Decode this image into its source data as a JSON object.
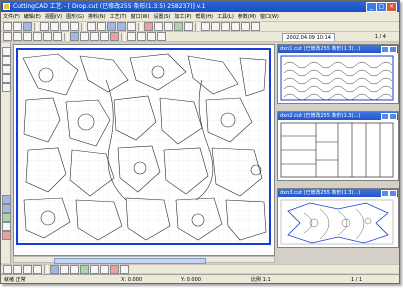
{
  "window": {
    "title": "CuttingCAD 工艺 - [ Drop.cut  (已修改255 条形(1.3.5) 258237)] v.1",
    "buttons": [
      "_",
      "□",
      "×"
    ]
  },
  "menu": {
    "items": [
      "文件(F)",
      "编辑(E)",
      "视图(V)",
      "图形(G)",
      "排料(N)",
      "工艺(T)",
      "窗口(W)",
      "设置(S)",
      "加工(P)",
      "帮助(H)",
      "工具(L)",
      "参数(M)",
      "窗口(W)"
    ]
  },
  "toolbar": {
    "date": "2002.04.09 10:14",
    "page": "1 / 4"
  },
  "panels": [
    {
      "title": "dxn1.cut  (已修改255 条形(1.3)...)"
    },
    {
      "title": "dxn2.cut  (已修改255 条形(1.3)...)"
    },
    {
      "title": "dxn3.cut  (已修改255 条形(1.3)...)"
    }
  ],
  "status": {
    "left": "就绪  正常",
    "mid1": "X: 0.000",
    "mid2": "Y: 0.000",
    "mid3": "比例 1:1",
    "right": "1 / 1"
  },
  "colors": {
    "title_bar": "#1b4fc0",
    "canvas_border": "#1a3cd6",
    "chrome": "#ece9d8"
  }
}
